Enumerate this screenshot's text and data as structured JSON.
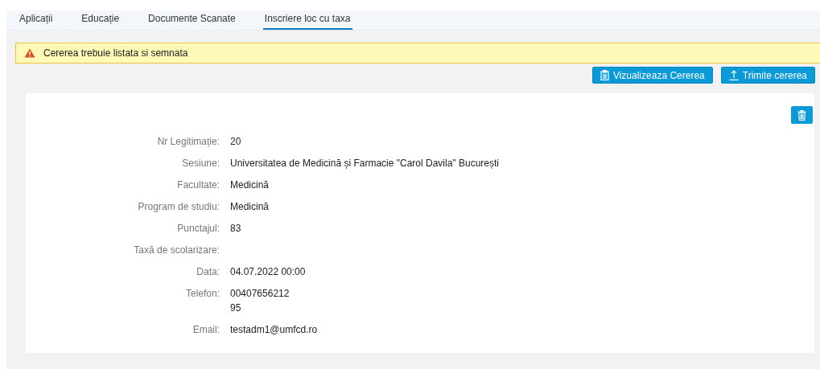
{
  "tabs": [
    {
      "label": "Aplicații",
      "selected": false
    },
    {
      "label": "Educație",
      "selected": false
    },
    {
      "label": "Documente Scanate",
      "selected": false
    },
    {
      "label": "Inscriere loc cu taxa",
      "selected": true
    }
  ],
  "alert": {
    "kind": "warning",
    "message": "Cererea trebuie listata si semnata"
  },
  "actions": [
    {
      "label": "Vizualizeaza Cererea",
      "kind": "view"
    },
    {
      "label": "Trimite cererea",
      "kind": "upload"
    }
  ],
  "details": [
    {
      "label": "Nr Legitimație:",
      "lines": [
        "20"
      ]
    },
    {
      "label": "Sesiune:",
      "lines": [
        "Universitatea de Medicină și Farmacie \"Carol Davila\" București"
      ]
    },
    {
      "label": "Facultate:",
      "lines": [
        "Medicină"
      ]
    },
    {
      "label": "Program de studiu:",
      "lines": [
        "Medicină"
      ]
    },
    {
      "label": "Punctajul:",
      "lines": [
        "83"
      ]
    },
    {
      "label": "Taxă de scolarizare:"
    },
    {
      "label": "Data:",
      "lines": [
        "04.07.2022 00:00"
      ]
    },
    {
      "label": "Telefon:",
      "lines": [
        "00407656212",
        "95"
      ]
    },
    {
      "label": "Email:",
      "lines": [
        "testadm1@umfcd.ro"
      ]
    }
  ]
}
